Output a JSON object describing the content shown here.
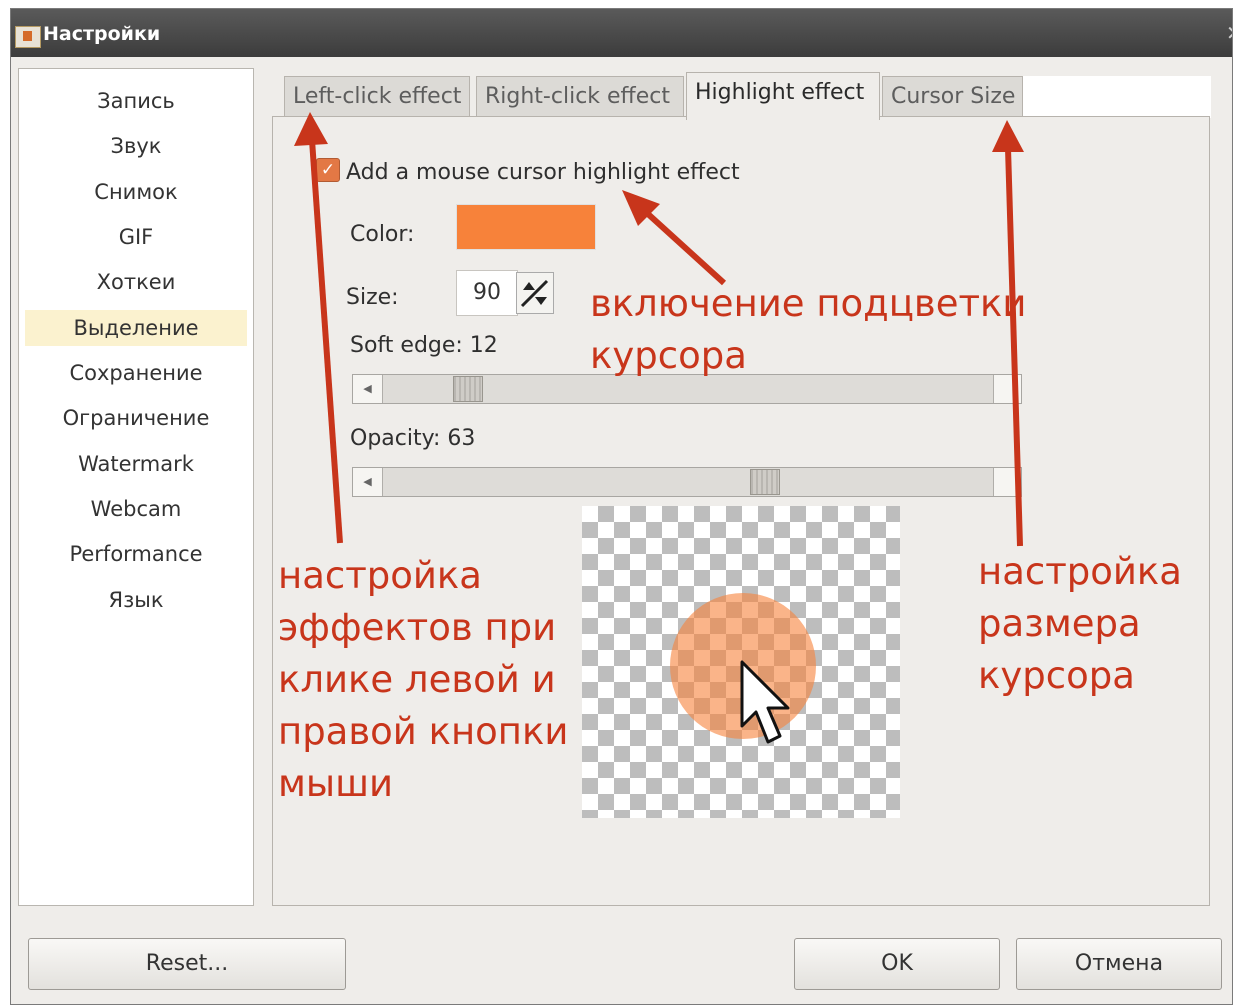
{
  "window": {
    "title": "Настройки"
  },
  "sidebar": {
    "items": [
      {
        "label": "Запись"
      },
      {
        "label": "Звук"
      },
      {
        "label": "Снимок"
      },
      {
        "label": "GIF"
      },
      {
        "label": "Хоткеи"
      },
      {
        "label": "Выделение",
        "active": true
      },
      {
        "label": "Сохранение"
      },
      {
        "label": "Ограничение"
      },
      {
        "label": "Watermark"
      },
      {
        "label": "Webcam"
      },
      {
        "label": "Performance"
      },
      {
        "label": "Язык"
      }
    ]
  },
  "tabs": [
    {
      "label": "Left-click effect"
    },
    {
      "label": "Right-click effect"
    },
    {
      "label": "Highlight effect",
      "active": true
    },
    {
      "label": "Cursor Size"
    }
  ],
  "highlight": {
    "enable_label": "Add a mouse cursor highlight effect",
    "enabled": true,
    "color_label": "Color:",
    "color_value": "#f7823a",
    "size_label": "Size:",
    "size_value": "90",
    "soft_edge_label": "Soft edge: 12",
    "soft_edge_value": 12,
    "opacity_label": "Opacity: 63",
    "opacity_value": 63
  },
  "annotations": {
    "highlight_note": [
      "включение подцветки",
      "курсора"
    ],
    "click_note": [
      "настройка",
      "эффектов при",
      "клике левой и",
      "правой кнопки",
      "мыши"
    ],
    "size_note": [
      "настройка",
      "размера",
      "курсора"
    ],
    "color": "#c8351b"
  },
  "buttons": {
    "reset": "Reset...",
    "ok": "OK",
    "cancel": "Отмена"
  }
}
